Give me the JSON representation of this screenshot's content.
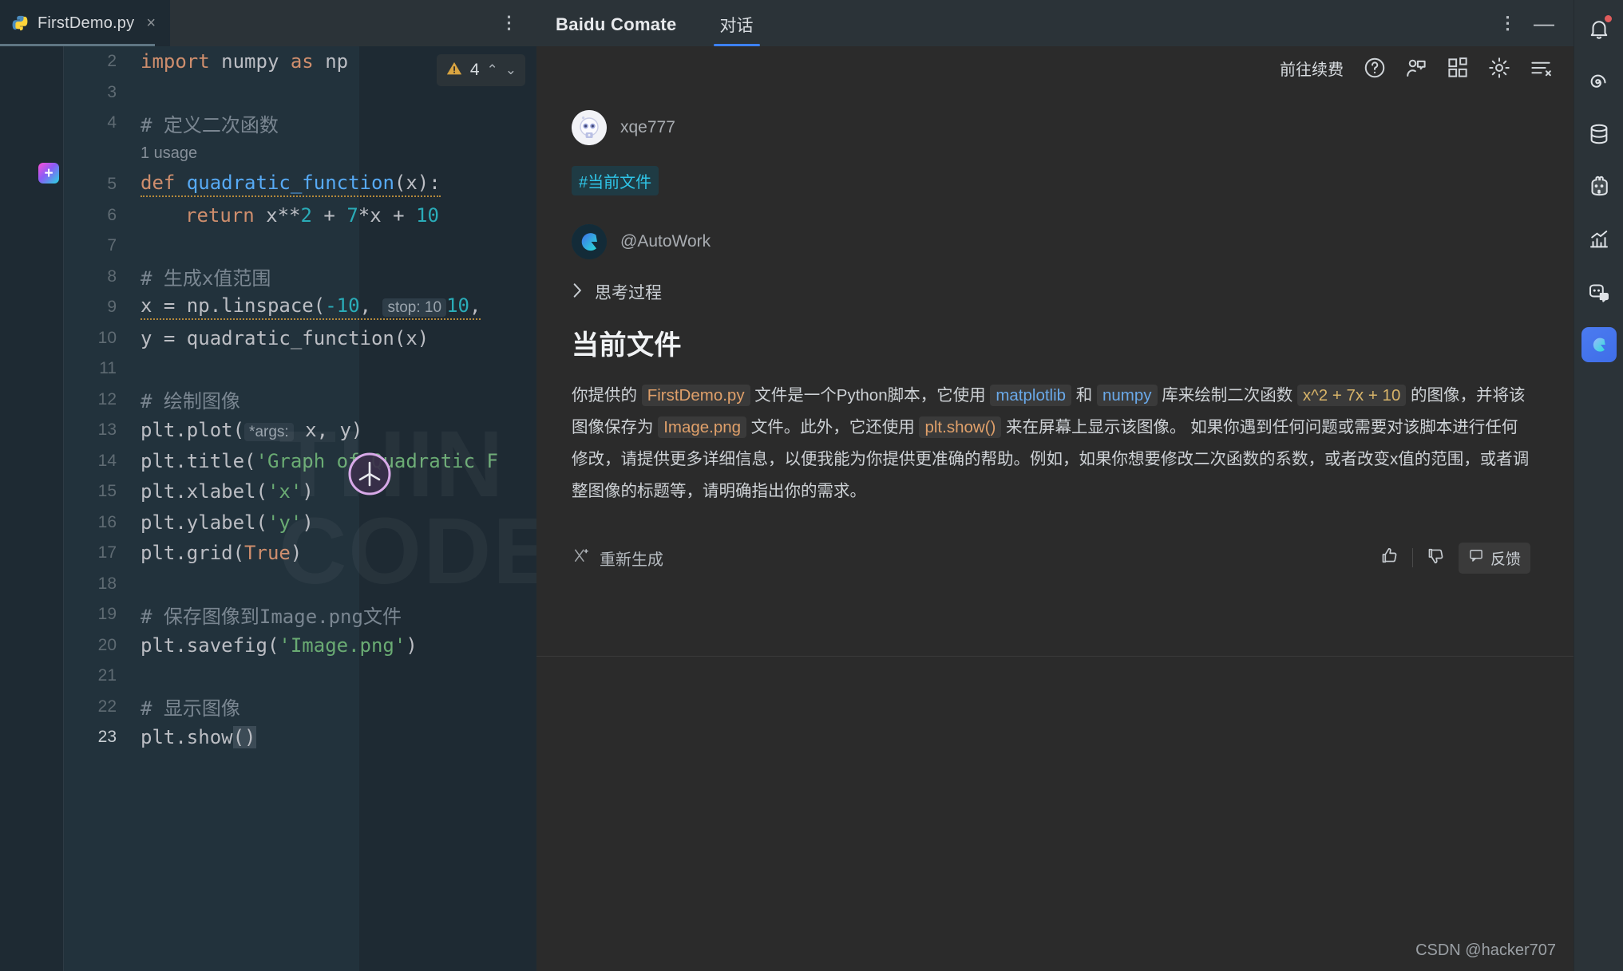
{
  "ide": {
    "tab": {
      "filename": "FirstDemo.py",
      "icon": "python-icon",
      "close": "×"
    },
    "tab_more_icon": "more-vertical-icon",
    "inspection": {
      "count": "4",
      "icon": "warning-triangle-icon",
      "up": "⌃",
      "down": "⌄"
    },
    "gutter_mark": "+",
    "usage_hint": "1 usage",
    "watermark_line1": "THIN",
    "watermark_line2": "CODE",
    "lines": [
      {
        "no": "2",
        "current": false
      },
      {
        "no": "3",
        "current": false
      },
      {
        "no": "4",
        "current": false
      },
      {
        "no": "5",
        "current": false
      },
      {
        "no": "6",
        "current": false
      },
      {
        "no": "7",
        "current": false
      },
      {
        "no": "8",
        "current": false
      },
      {
        "no": "9",
        "current": false
      },
      {
        "no": "10",
        "current": false
      },
      {
        "no": "11",
        "current": false
      },
      {
        "no": "12",
        "current": false
      },
      {
        "no": "13",
        "current": false
      },
      {
        "no": "14",
        "current": false
      },
      {
        "no": "15",
        "current": false
      },
      {
        "no": "16",
        "current": false
      },
      {
        "no": "17",
        "current": false
      },
      {
        "no": "18",
        "current": false
      },
      {
        "no": "19",
        "current": false
      },
      {
        "no": "20",
        "current": false
      },
      {
        "no": "21",
        "current": false
      },
      {
        "no": "22",
        "current": false
      },
      {
        "no": "23",
        "current": true
      }
    ],
    "code": {
      "l2_import": "import",
      "l2_rest": " numpy ",
      "l2_as": "as",
      "l2_np": " np",
      "l4_comment": "# 定义二次函数",
      "l5_def": "def",
      "l5_name": " quadratic_function",
      "l5_tail": "(x):",
      "l6_return": "return",
      "l6_expr_a": " x**",
      "l6_two": "2",
      "l6_plus1": " + ",
      "l6_seven": "7",
      "l6_x": "*x",
      "l6_plus2": " + ",
      "l6_ten": "10",
      "l8_comment": "# 生成x值范围",
      "l9_a": "x = np.linspace(",
      "l9_neg10": "-10",
      "l9_comma": ", ",
      "l9_hint": "stop: 10",
      "l9_hint_tail": ",",
      "l10": "y = quadratic_function(x)",
      "l12_comment": "# 绘制图像",
      "l13_a": "plt.plot(",
      "l13_hint": "*args:",
      "l13_b": " x, y)",
      "l14_a": "plt.title(",
      "l14_str": "'Graph of Quadratic F",
      "l15_a": "plt.xlabel(",
      "l15_str": "'x'",
      "l15_b": ")",
      "l16_a": "plt.ylabel(",
      "l16_str": "'y'",
      "l16_b": ")",
      "l17_a": "plt.grid(",
      "l17_true": "True",
      "l17_b": ")",
      "l19_comment": "# 保存图像到Image.png文件",
      "l20_a": "plt.savefig(",
      "l20_str": "'Image.png'",
      "l20_b": ")",
      "l22_comment": "# 显示图像",
      "l23_a": "plt.show",
      "l23_b": "()"
    }
  },
  "comate": {
    "title": "Baidu Comate",
    "tabs": [
      {
        "label": "对话",
        "active": true
      }
    ],
    "header_icons": [
      {
        "name": "more-vertical-icon"
      },
      {
        "name": "minimize-icon"
      }
    ],
    "toolbar": {
      "renew_label": "前往续费",
      "icons": [
        {
          "name": "help-circle-icon"
        },
        {
          "name": "user-chat-icon"
        },
        {
          "name": "apps-grid-icon"
        },
        {
          "name": "gear-icon"
        },
        {
          "name": "clear-list-icon"
        }
      ]
    },
    "user_message": {
      "avatar": "robot-avatar-icon",
      "username": "xqe777",
      "file_tag": "#当前文件"
    },
    "ai_message": {
      "logo": "comate-logo-icon",
      "agent": "@AutoWork",
      "thinking_label": "思考过程",
      "thinking_chevron": "chevron-right-icon",
      "heading": "当前文件",
      "paragraph": {
        "p1": "你提供的 ",
        "code1": "FirstDemo.py",
        "p2": " 文件是一个Python脚本，它使用 ",
        "code2": "matplotlib",
        "p3": " 和 ",
        "code3": "numpy",
        "p4": " 库来绘制二次函数 ",
        "code4": "x^2 + 7x + 10",
        "p5": " 的图像，并将该图像保存为 ",
        "code5": "Image.png",
        "p6": " 文件。此外，它还使用 ",
        "code6": "plt.show()",
        "p7": " 来在屏幕上显示该图像。 如果你遇到任何问题或需要对该脚本进行任何修改，请提供更多详细信息，以便我能为你提供更准确的帮助。例如，如果你想要修改二次函数的系数，或者改变x值的范围，或者调整图像的标题等，请明确指出你的需求。"
      },
      "actions": {
        "regenerate": "重新生成",
        "regenerate_icon": "refresh-sparkle-icon",
        "thumbs_up_icon": "thumbs-up-icon",
        "thumbs_down_icon": "thumbs-down-icon",
        "feedback_label": "反馈",
        "feedback_icon": "feedback-icon"
      }
    }
  },
  "rail": {
    "items": [
      {
        "name": "notifications-icon",
        "badge": true,
        "active": false
      },
      {
        "name": "spiral-icon",
        "badge": false,
        "active": false
      },
      {
        "name": "database-icon",
        "badge": false,
        "active": false
      },
      {
        "name": "bot-icon",
        "badge": false,
        "active": false
      },
      {
        "name": "chart-icon",
        "badge": false,
        "active": false
      },
      {
        "name": "bot-chat-icon",
        "badge": false,
        "active": false
      },
      {
        "name": "comate-icon",
        "badge": false,
        "active": true
      }
    ]
  },
  "watermark": {
    "csdn": "CSDN @hacker707"
  }
}
